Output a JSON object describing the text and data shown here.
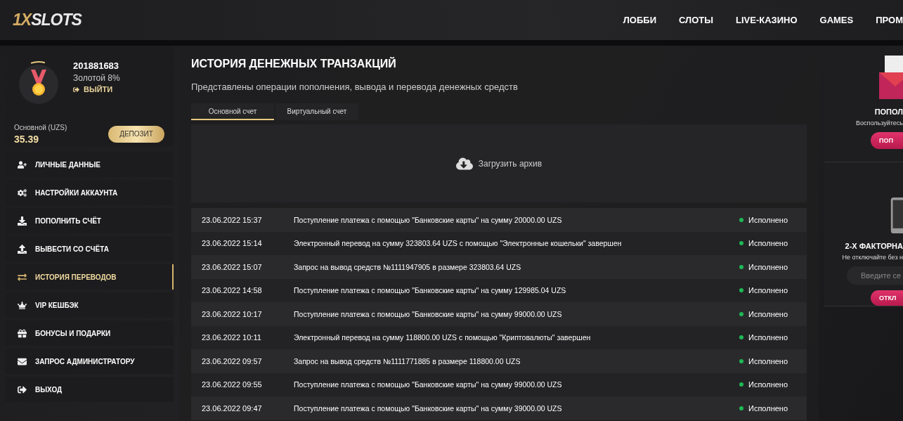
{
  "header": {
    "logo_accent": "1X",
    "logo_rest": "SLOTS",
    "nav": [
      "ЛОББИ",
      "СЛОТЫ",
      "LIVE-КАЗИНО",
      "GAMES",
      "ПРОМ"
    ]
  },
  "profile": {
    "id": "201881683",
    "status": "Золотой 8%",
    "progress": {
      "level": 0.1
    },
    "logout": "ВЫЙТИ",
    "balance_label": "Основной (UZS)",
    "balance": "35.39",
    "deposit": "ДЕПОЗИТ"
  },
  "menu": [
    {
      "label": "ЛИЧНЫЕ ДАННЫЕ",
      "selected": false
    },
    {
      "label": "НАСТРОЙКИ АККАУНТА",
      "selected": false
    },
    {
      "label": "ПОПОЛНИТЬ СЧЁТ",
      "selected": false
    },
    {
      "label": "ВЫВЕСТИ СО СЧЁТА",
      "selected": false
    },
    {
      "label": "ИСТОРИЯ ПЕРЕВОДОВ",
      "selected": true
    },
    {
      "label": "VIP КЕШБЭК",
      "selected": false
    },
    {
      "label": "БОНУСЫ И ПОДАРКИ",
      "selected": false
    },
    {
      "label": "ЗАПРОС АДМИНИСТРАТОРУ",
      "selected": false
    },
    {
      "label": "ВЫХОД",
      "selected": false
    }
  ],
  "main": {
    "title": "ИСТОРИЯ ДЕНЕЖНЫХ ТРАНЗАКЦИЙ",
    "subtitle": "Представлены операции пополнения, вывода и перевода денежных средств",
    "tabs": [
      {
        "label": "Основной счет",
        "selected": true
      },
      {
        "label": "Виртуальный счет",
        "selected": false
      }
    ],
    "archive": "Загрузить архив",
    "rows": [
      {
        "date": "23.06.2022 15:37",
        "text": "Поступление платежа с помощью \"Банковские карты\" на сумму 20000.00 UZS",
        "status": "Исполнено"
      },
      {
        "date": "23.06.2022 15:14",
        "text": "Электронный перевод на сумму 323803.64 UZS с помощью \"Электронные кошельки\" завершен",
        "status": "Исполнено"
      },
      {
        "date": "23.06.2022 15:07",
        "text": "Запрос на вывод средств №1111947905 в размере 323803.64 UZS",
        "status": "Исполнено"
      },
      {
        "date": "23.06.2022 14:58",
        "text": "Поступление платежа с помощью \"Банковские карты\" на сумму 129985.04 UZS",
        "status": "Исполнено"
      },
      {
        "date": "23.06.2022 10:17",
        "text": "Поступление платежа с помощью \"Банковские карты\" на сумму 99000.00 UZS",
        "status": "Исполнено"
      },
      {
        "date": "23.06.2022 10:11",
        "text": "Электронный перевод на сумму 118800.00 UZS с помощью \"Криптовалюты\" завершен",
        "status": "Исполнено"
      },
      {
        "date": "23.06.2022 09:57",
        "text": "Запрос на вывод средств №1111771885 в размере 118800.00 UZS",
        "status": "Исполнено"
      },
      {
        "date": "23.06.2022 09:55",
        "text": "Поступление платежа с помощью \"Банковские карты\" на сумму 99000.00 UZS",
        "status": "Исполнено"
      },
      {
        "date": "23.06.2022 09:47",
        "text": "Поступление платежа с помощью \"Банковские карты\" на сумму 39000.00 UZS",
        "status": "Исполнено"
      }
    ]
  },
  "side": {
    "promo_title": "ПОПОЛ",
    "promo_text": "Воспользуйтесь",
    "promo_button": "ПОП",
    "twofa_title": "2-Х ФАКТОРНА",
    "twofa_text": "Не отключайте без н",
    "twofa_placeholder": "Введите се",
    "twofa_button": "ОТКЛ"
  }
}
